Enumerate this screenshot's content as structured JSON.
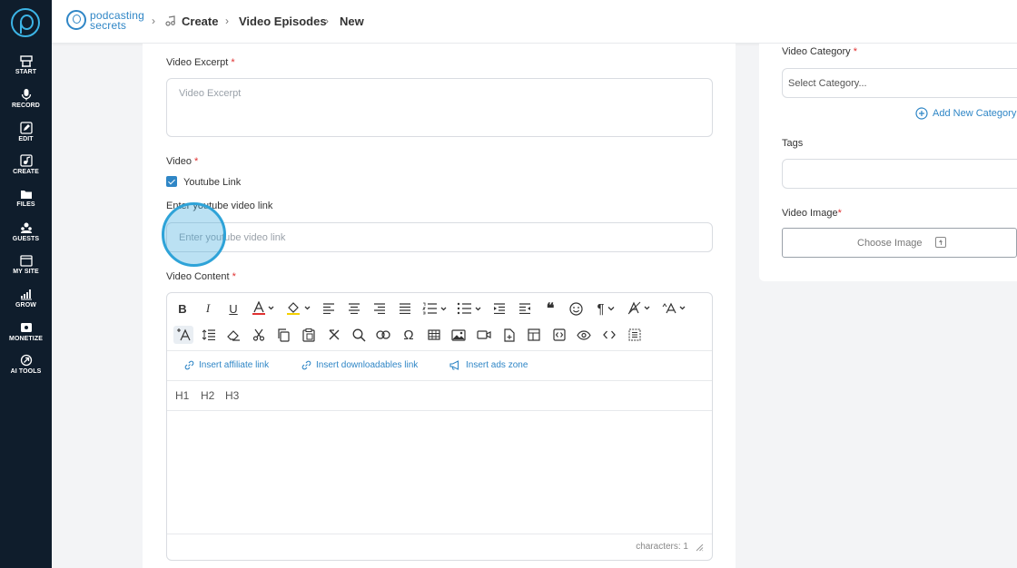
{
  "sidebar": {
    "items": [
      {
        "label": "START",
        "icon": "start-icon"
      },
      {
        "label": "RECORD",
        "icon": "microphone-icon"
      },
      {
        "label": "EDIT",
        "icon": "edit-icon"
      },
      {
        "label": "CREATE",
        "icon": "create-icon"
      },
      {
        "label": "FILES",
        "icon": "files-icon"
      },
      {
        "label": "GUESTS",
        "icon": "guests-icon"
      },
      {
        "label": "MY SITE",
        "icon": "my-site-icon"
      },
      {
        "label": "GROW",
        "icon": "grow-icon"
      },
      {
        "label": "MONETIZE",
        "icon": "monetize-icon"
      },
      {
        "label": "AI TOOLS",
        "icon": "ai-tools-icon"
      }
    ]
  },
  "header": {
    "brand_line1": "podcasting",
    "brand_line2": "secrets",
    "breadcrumbs": [
      "Create",
      "Video Episodes",
      "New"
    ]
  },
  "form": {
    "excerpt": {
      "label": "Video Excerpt",
      "required": "*",
      "placeholder": "Video Excerpt"
    },
    "video": {
      "label": "Video",
      "required": "*",
      "checkbox_label": "Youtube Link",
      "checked": true
    },
    "youtube": {
      "label": "Enter youtube video link",
      "placeholder": "Enter youtube video link"
    },
    "content": {
      "label": "Video Content",
      "required": "*",
      "toolbar_text": {
        "bold": "B",
        "italic": "I",
        "underline": "U",
        "quote": "❝",
        "paragraph": "¶",
        "omega": "Ω"
      },
      "insert_links": [
        "Insert affiliate link",
        "Insert downloadables link",
        "Insert ads zone"
      ],
      "headings": [
        "H1",
        "H2",
        "H3"
      ],
      "char_count": "characters: 1"
    }
  },
  "right": {
    "category": {
      "label": "Video Category",
      "required": "*",
      "placeholder": "Select Category...",
      "add_label": "Add New Category"
    },
    "tags": {
      "label": "Tags"
    },
    "image": {
      "label": "Video Image",
      "required": "*",
      "button_label": "Choose Image"
    }
  },
  "colors": {
    "sidebar_bg": "#0f1d2c",
    "accent": "#2f86c6",
    "required": "#e03131"
  }
}
